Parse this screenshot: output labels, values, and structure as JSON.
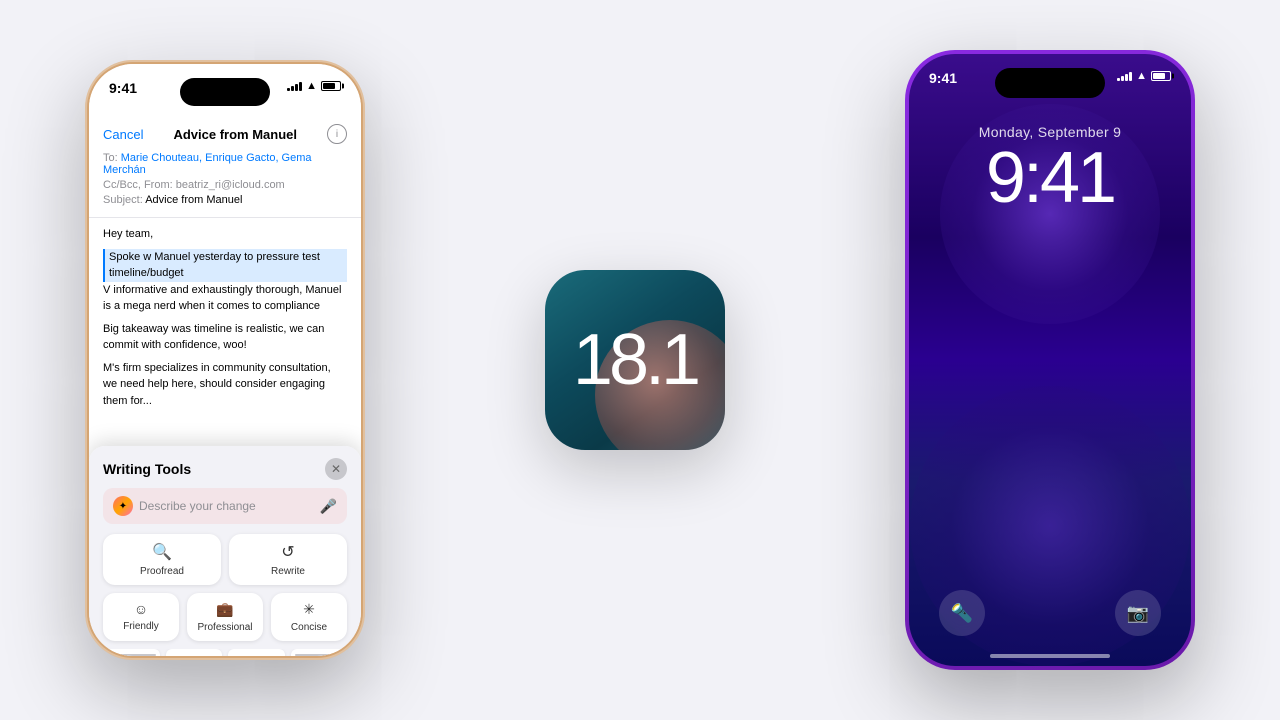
{
  "background_color": "#f2f2f7",
  "left_phone": {
    "time": "9:41",
    "email": {
      "cancel_label": "Cancel",
      "subject": "Advice from Manuel",
      "to_label": "To:",
      "recipients": "Marie Chouteau, Enrique Gacto, Gema Merchán",
      "cc_label": "Cc/Bcc, From:",
      "cc_value": "beatriz_ri@icloud.com",
      "subject_label": "Subject:",
      "subject_value": "Advice from Manuel",
      "greeting": "Hey team,",
      "body_line1": "Spoke w Manuel yesterday to pressure test timeline/budget",
      "body_line2": "V informative and exhaustingly thorough, Manuel is a mega nerd when it comes to compliance",
      "body_line3": "Big takeaway was timeline is realistic, we can commit with confidence, woo!",
      "body_line4": "M's firm specializes in community consultation, we need help here, should consider engaging them for..."
    },
    "writing_tools": {
      "title": "Writing Tools",
      "placeholder": "Describe your change",
      "proofread_label": "Proofread",
      "rewrite_label": "Rewrite",
      "friendly_label": "Friendly",
      "professional_label": "Professional",
      "concise_label": "Concise"
    }
  },
  "center": {
    "version": "18.1"
  },
  "right_phone": {
    "status_time": "9:41",
    "date": "Monday, September 9",
    "time": "9:41",
    "flashlight_icon": "🔦",
    "camera_icon": "📷"
  }
}
